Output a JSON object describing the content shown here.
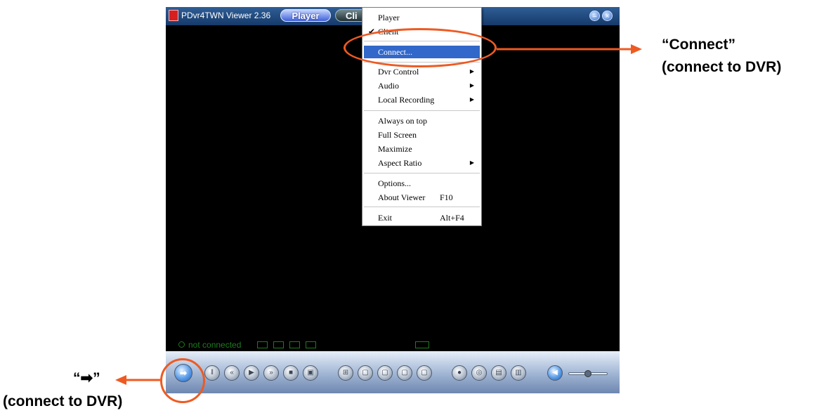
{
  "window": {
    "title": "PDvr4TWN Viewer 2.36",
    "tab_player": "Player",
    "tab_client": "Cli",
    "minimize_glyph": "–",
    "close_glyph": "×"
  },
  "status": {
    "text": "not connected"
  },
  "menu": {
    "items": [
      {
        "label": "Player",
        "shortcut": "",
        "submenu": false,
        "checked": false
      },
      {
        "label": "Client",
        "shortcut": "",
        "submenu": false,
        "checked": true
      },
      {
        "label": "Connect...",
        "shortcut": "",
        "submenu": false,
        "checked": false,
        "highlighted": true
      },
      {
        "label": "Dvr Control",
        "shortcut": "",
        "submenu": true,
        "checked": false
      },
      {
        "label": "Audio",
        "shortcut": "",
        "submenu": true,
        "checked": false
      },
      {
        "label": "Local Recording",
        "shortcut": "",
        "submenu": true,
        "checked": false
      },
      {
        "label": "Always on top",
        "shortcut": "",
        "submenu": false,
        "checked": false
      },
      {
        "label": "Full Screen",
        "shortcut": "",
        "submenu": false,
        "checked": false
      },
      {
        "label": "Maximize",
        "shortcut": "",
        "submenu": false,
        "checked": false
      },
      {
        "label": "Aspect Ratio",
        "shortcut": "",
        "submenu": true,
        "checked": false
      },
      {
        "label": "Options...",
        "shortcut": "",
        "submenu": false,
        "checked": false
      },
      {
        "label": "About Viewer",
        "shortcut": "F10",
        "submenu": false,
        "checked": false
      },
      {
        "label": "Exit",
        "shortcut": "Alt+F4",
        "submenu": false,
        "checked": false
      }
    ],
    "check_glyph": "✔",
    "submenu_glyph": "▶"
  },
  "callouts": {
    "menu_title": "“Connect”",
    "menu_sub": "(connect to DVR)",
    "button_title": "“➡”",
    "button_sub": "(connect to DVR)"
  },
  "colors": {
    "annotation": "#ee5a22",
    "menu_highlight": "#3168c9"
  }
}
